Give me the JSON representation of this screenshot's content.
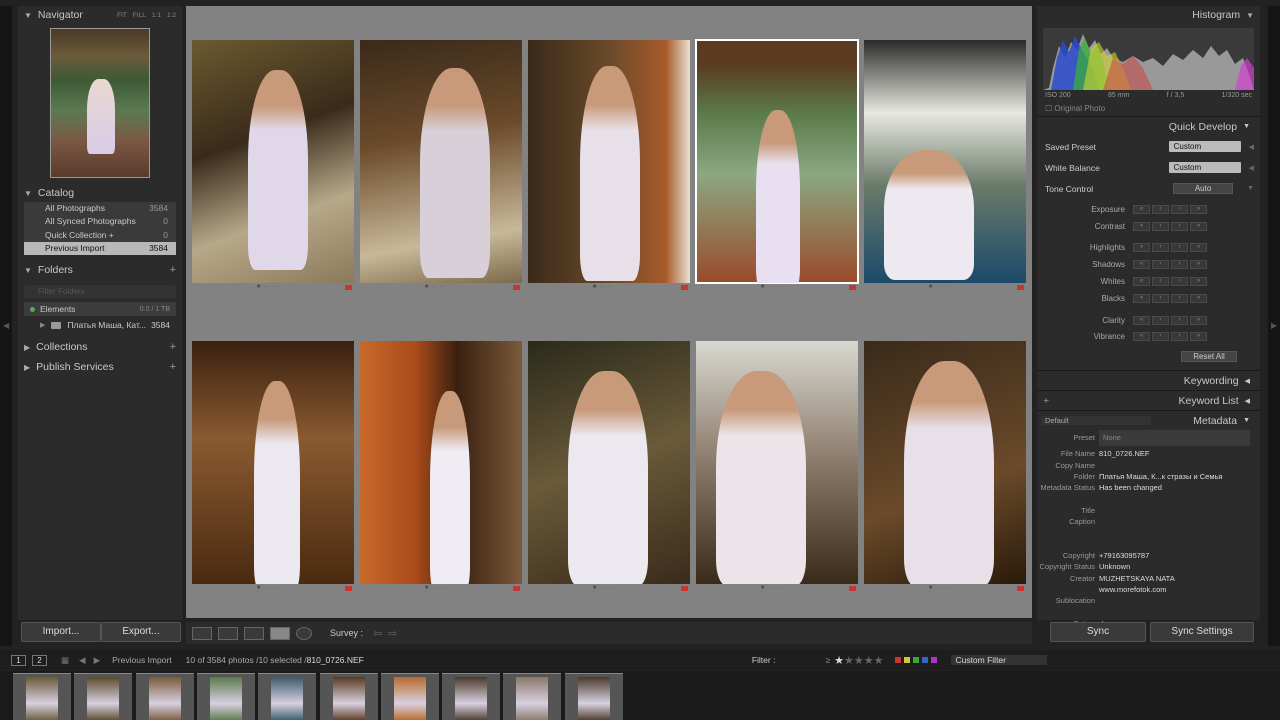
{
  "navigator": {
    "title": "Navigator",
    "controls": [
      "FIT",
      "FILL",
      "1:1",
      "1:2"
    ]
  },
  "catalog": {
    "title": "Catalog",
    "items": [
      {
        "label": "All Photographs",
        "count": "3584"
      },
      {
        "label": "All Synced Photographs",
        "count": "0"
      },
      {
        "label": "Quick Collection +",
        "count": "0"
      },
      {
        "label": "Previous Import",
        "count": "3584"
      }
    ]
  },
  "folders": {
    "title": "Folders",
    "filter_placeholder": "Filter Folders",
    "volume": "Elements",
    "volume_size": "0.0 / 1 TB",
    "folder": "Платья Маша, Кат...",
    "folder_count": "3584"
  },
  "collections": {
    "title": "Collections"
  },
  "publish": {
    "title": "Publish Services"
  },
  "buttons": {
    "import": "Import...",
    "export": "Export...",
    "sync": "Sync",
    "sync_settings": "Sync Settings"
  },
  "toolbar": {
    "mode": "Survey :"
  },
  "histogram": {
    "title": "Histogram",
    "iso": "ISO 200",
    "focal": "85 mm",
    "aperture": "f / 3,5",
    "shutter": "1/320 sec",
    "original": "Original Photo"
  },
  "quick_develop": {
    "title": "Quick Develop",
    "saved_preset_label": "Saved Preset",
    "saved_preset": "Custom",
    "wb_label": "White Balance",
    "wb": "Custom",
    "tone_label": "Tone Control",
    "auto": "Auto",
    "tone_rows": [
      "Exposure",
      "Contrast",
      "Highlights",
      "Shadows",
      "Whites",
      "Blacks",
      "Clarity",
      "Vibrance"
    ],
    "reset": "Reset All"
  },
  "keywording": {
    "title": "Keywording"
  },
  "keyword_list": {
    "title": "Keyword List"
  },
  "metadata": {
    "title": "Metadata",
    "preset_set": "Default",
    "preset_label": "Preset",
    "preset": "None",
    "rows": [
      {
        "label": "File Name",
        "value": "810_0726.NEF"
      },
      {
        "label": "Copy Name",
        "value": ""
      },
      {
        "label": "Folder",
        "value": "Платья Маша, К...к стразы и Семья"
      },
      {
        "label": "Metadata Status",
        "value": "Has been changed"
      },
      {
        "label": "",
        "value": ""
      },
      {
        "label": "Title",
        "value": ""
      },
      {
        "label": "Caption",
        "value": ""
      },
      {
        "label": "",
        "value": ""
      },
      {
        "label": "",
        "value": ""
      },
      {
        "label": "Copyright",
        "value": "+79163095787"
      },
      {
        "label": "Copyright Status",
        "value": "Unknown"
      },
      {
        "label": "Creator",
        "value": "MUZHETSKAYA NATA"
      },
      {
        "label": "",
        "value": "www.morefotok.com"
      },
      {
        "label": "Sublocation",
        "value": ""
      },
      {
        "label": "",
        "value": ""
      },
      {
        "label": "Rating",
        "value": "★ · · · ·"
      }
    ]
  },
  "filmstrip": {
    "source": "Previous Import",
    "info": "10 of 3584 photos /10 selected /",
    "file": "810_0726.NEF",
    "page1": "1",
    "page2": "2",
    "filter_label": "Filter :",
    "filter_value": "Custom Filter"
  }
}
